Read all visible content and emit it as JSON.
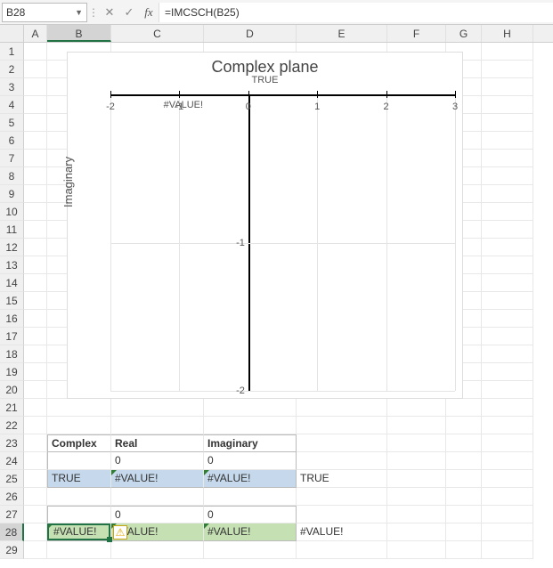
{
  "formula_bar": {
    "cell_ref": "B28",
    "formula": "=IMCSCH(B25)"
  },
  "columns": [
    "A",
    "B",
    "C",
    "D",
    "E",
    "F",
    "G",
    "H"
  ],
  "rows": [
    "1",
    "2",
    "3",
    "4",
    "5",
    "6",
    "7",
    "8",
    "9",
    "10",
    "11",
    "12",
    "13",
    "14",
    "15",
    "16",
    "17",
    "18",
    "19",
    "20",
    "21",
    "22",
    "23",
    "24",
    "25",
    "26",
    "27",
    "28",
    "29"
  ],
  "table": {
    "headers": {
      "complex": "Complex",
      "real": "Real",
      "imaginary": "Imaginary"
    },
    "r24": {
      "c": "0",
      "d": "0"
    },
    "r25": {
      "b": "TRUE",
      "c": "#VALUE!",
      "d": "#VALUE!",
      "e": "TRUE"
    },
    "r27": {
      "c": "0",
      "d": "0"
    },
    "r28": {
      "b": "#VALUE!",
      "c": "#VALUE!",
      "d": "#VALUE!",
      "e": "#VALUE!"
    }
  },
  "chart_data": {
    "type": "scatter",
    "title": "Complex plane",
    "subtitle": "TRUE",
    "xlabel": "",
    "ylabel": "Imaginary",
    "xlim": [
      -2,
      3
    ],
    "ylim": [
      -2,
      0
    ],
    "x_ticks": [
      -2,
      -1,
      0,
      1,
      2,
      3
    ],
    "y_ticks": [
      0,
      -1,
      -2
    ],
    "series_label": "#VALUE!",
    "series": [
      {
        "name": "#VALUE!",
        "x": [],
        "y": []
      }
    ]
  }
}
